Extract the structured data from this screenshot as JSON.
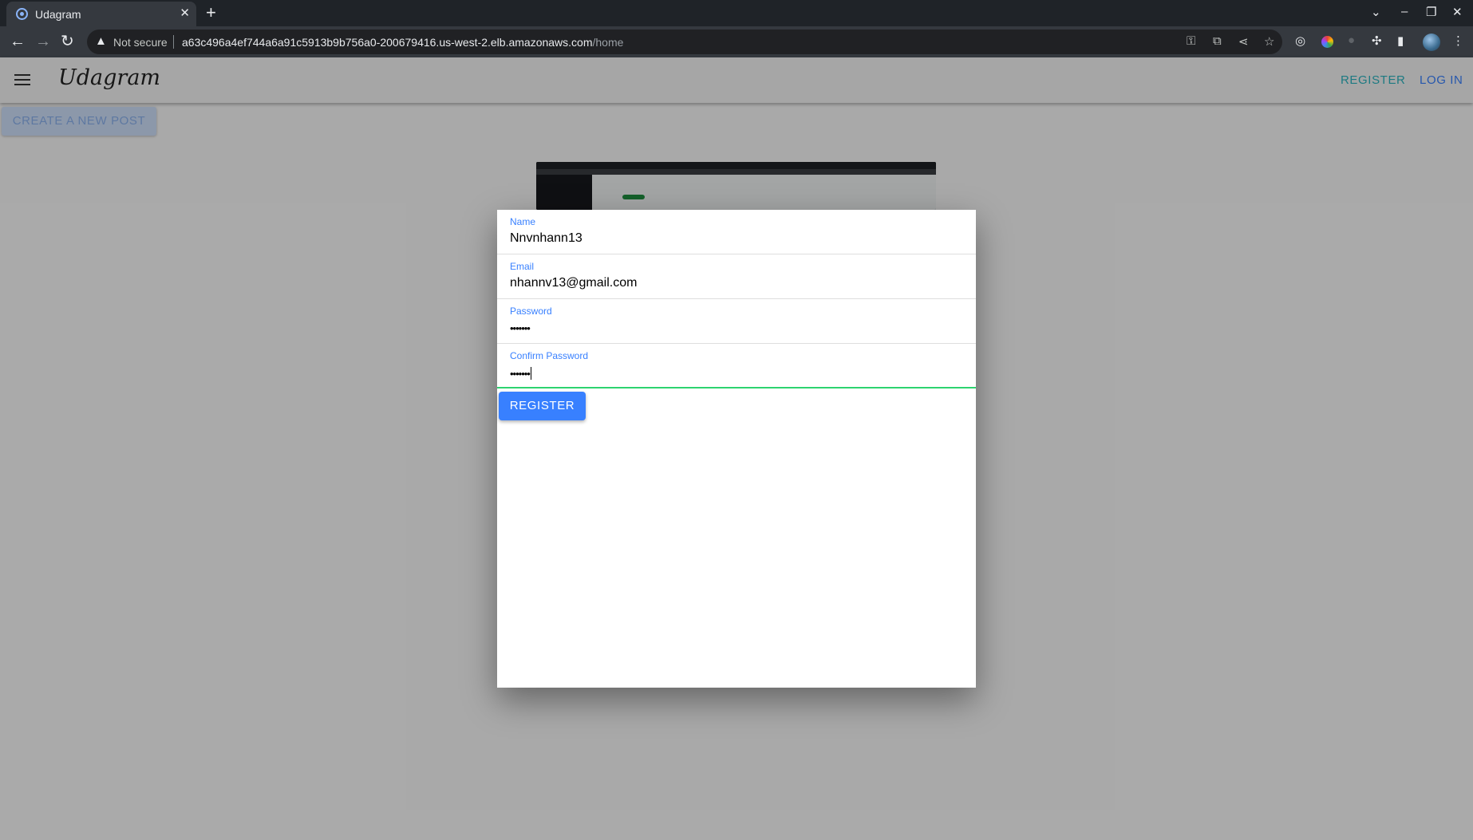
{
  "browser": {
    "tab_title": "Udagram",
    "security_label": "Not secure",
    "url_host": "a63c496a4ef744a6a91c5913b9b756a0-200679416.us-west-2.elb.amazonaws.com",
    "url_path": "/home"
  },
  "app": {
    "logo": "Udagram",
    "nav": {
      "register": "REGISTER",
      "login": "LOG IN"
    },
    "create_post_label": "CREATE A NEW POST"
  },
  "register_form": {
    "fields": [
      {
        "label": "Name",
        "value": "Nnvnhann13"
      },
      {
        "label": "Email",
        "value": "nhannv13@gmail.com"
      },
      {
        "label": "Password",
        "value": "•••••••"
      },
      {
        "label": "Confirm Password",
        "value": "•••••••"
      }
    ],
    "submit_label": "REGISTER"
  },
  "colors": {
    "primary": "#3880ff",
    "success": "#2dd36f",
    "secondary": "#2bb4c0"
  }
}
